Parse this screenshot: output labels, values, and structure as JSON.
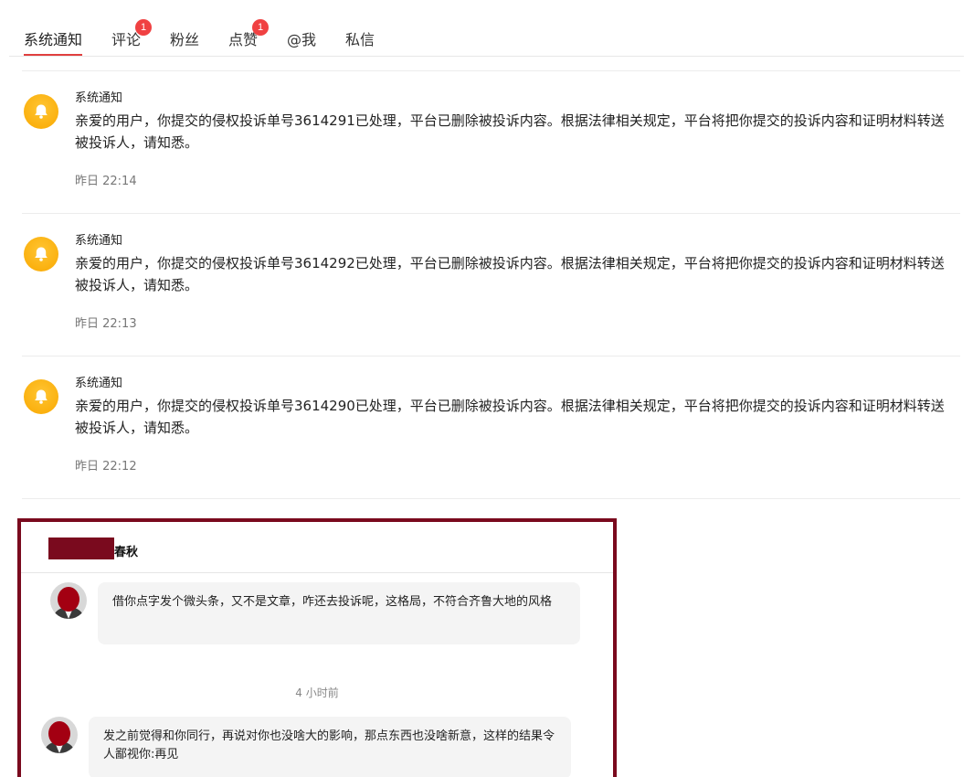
{
  "tabs": [
    {
      "label": "系统通知",
      "active": true
    },
    {
      "label": "评论",
      "badge": "1"
    },
    {
      "label": "粉丝"
    },
    {
      "label": "点赞",
      "badge": "1"
    },
    {
      "label": "@我"
    },
    {
      "label": "私信"
    }
  ],
  "notifications": [
    {
      "title": "系统通知",
      "body": "亲爱的用户，你提交的侵权投诉单号3614291已处理，平台已删除被投诉内容。根据法律相关规定，平台将把你提交的投诉内容和证明材料转送被投诉人，请知悉。",
      "time": "昨日 22:14"
    },
    {
      "title": "系统通知",
      "body": "亲爱的用户，你提交的侵权投诉单号3614292已处理，平台已删除被投诉内容。根据法律相关规定，平台将把你提交的投诉内容和证明材料转送被投诉人，请知悉。",
      "time": "昨日 22:13"
    },
    {
      "title": "系统通知",
      "body": "亲爱的用户，你提交的侵权投诉单号3614290已处理，平台已删除被投诉内容。根据法律相关规定，平台将把你提交的投诉内容和证明材料转送被投诉人，请知悉。",
      "time": "昨日 22:12"
    }
  ],
  "chat": {
    "name": "春秋",
    "messages": [
      {
        "text": "借你点字发个微头条，又不是文章，咋还去投诉呢，这格局，不符合齐鲁大地的风格"
      },
      {
        "text": "发之前觉得和你同行，再说对你也没啥大的影响，那点东西也没啥新意，这样的结果令人鄙视你:再见"
      }
    ],
    "time": "4 小时前"
  },
  "colors": {
    "accent": "#e0403f",
    "badge": "#f04142",
    "bell": "#f9a800",
    "highlight_border": "#7a0a1e"
  }
}
